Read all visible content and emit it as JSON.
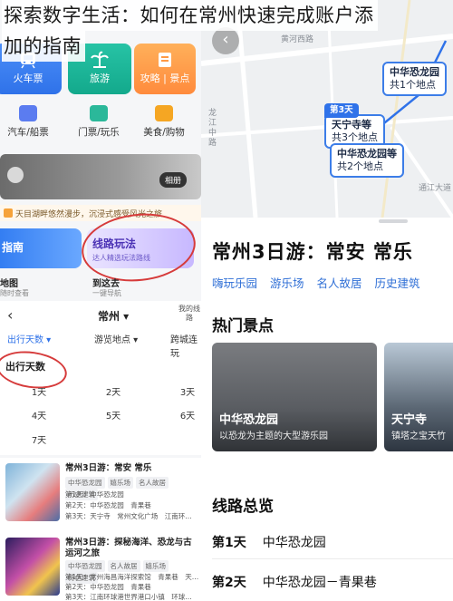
{
  "article_title": {
    "line1": "探索数字生活：如何在常州快速完成账户添",
    "line2": "加的指南"
  },
  "left_app": {
    "top_categories": [
      {
        "label": "火车票",
        "icon": "train-ticket-icon"
      },
      {
        "label": "旅游",
        "icon": "palm-tree-icon"
      },
      {
        "label": "攻略 | 景点",
        "icon": "guide-book-icon"
      }
    ],
    "second_categories": [
      {
        "label": "汽车/船票",
        "icon": "bus-icon"
      },
      {
        "label": "门票/玩乐",
        "icon": "ticket-icon"
      },
      {
        "label": "美食/购物",
        "icon": "shopping-bag-icon"
      }
    ],
    "banner": {
      "pill": "相册"
    },
    "notice": "天目湖畔悠然漫步，沉浸式感受风光之旅",
    "card_guide": "指南",
    "card_route": {
      "title": "线路玩法",
      "sub": "达人精选玩法路线"
    },
    "mini_links": {
      "a": "地图",
      "b": "到这去",
      "sa": "随时查看",
      "sb": "一键导航"
    },
    "picker": {
      "back": "‹",
      "city": "常州 ▾",
      "generate": "我的线路",
      "tabs": [
        "出行天数 ▾",
        "游览地点 ▾",
        "跨城连玩"
      ],
      "days_title": "出行天数",
      "days": [
        "1天",
        "2天",
        "3天",
        "4天",
        "5天",
        "6天",
        "7天"
      ]
    },
    "routes": [
      {
        "title": "常州3日游：常安 常乐",
        "tags": [
          "中华恐龙园",
          "嬉乐场",
          "名人故居",
          "历史建筑"
        ],
        "days": [
          "第1天：中华恐龙园",
          "第2天：中华恐龙园　青果巷",
          "第3天：天宁寺　常州文化广场　江南环…"
        ]
      },
      {
        "title": "常州3日游：探秘海洋、恐龙与古运河之旅",
        "tags": [
          "中华恐龙园",
          "名人故居",
          "嬉乐场",
          "特色建筑"
        ],
        "days": [
          "第1天：常州海昌海洋探索馆　青果巷　天…",
          "第2天：中华恐龙园　青果巷",
          "第3天：江南环球港世界港口小镇　环球…"
        ]
      }
    ]
  },
  "right_app": {
    "map": {
      "back": "‹",
      "labels": [
        "黄河西路",
        "龙江中路",
        "通江大道"
      ],
      "pins": [
        {
          "day": "",
          "name": "中华恐龙园",
          "sub": "共1个地点"
        },
        {
          "day": "第3天",
          "name": "天宁寺等",
          "sub": "共3个地点"
        },
        {
          "day": "",
          "name": "中华恐龙园等",
          "sub": "共2个地点"
        }
      ]
    },
    "title": "常州3日游：常安 常乐",
    "tags": [
      "嗨玩乐园",
      "游乐场",
      "名人故居",
      "历史建筑"
    ],
    "hot_spots_heading": "热门景点",
    "spots": [
      {
        "name": "中华恐龙园",
        "desc": "以恐龙为主题的大型游乐园"
      },
      {
        "name": "天宁寺",
        "desc": "镇塔之宝天竹"
      }
    ],
    "overview_heading": "线路总览",
    "day_rows": [
      {
        "day": "第1天",
        "place": "中华恐龙园"
      },
      {
        "day": "第2天",
        "place": "中华恐龙园－青果巷"
      }
    ]
  }
}
